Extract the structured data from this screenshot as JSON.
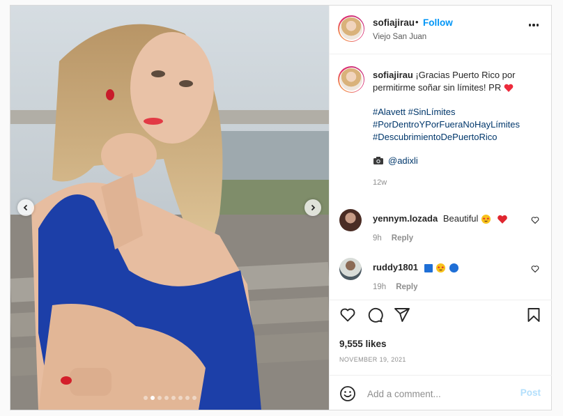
{
  "post": {
    "username": "sofiajirau",
    "separator": "•",
    "follow_label": "Follow",
    "location": "Viejo San Juan",
    "caption_text": "¡Gracias Puerto Rico por permitirme soñar sin límites! PR",
    "hashtags": [
      "#Alavett #SinLímites",
      "#PorDentroYPorFueraNoHayLímites",
      "#DescubrimientoDePuertoRico"
    ],
    "photo_credit": "@adixli",
    "caption_time": "12w",
    "likes": "9,555 likes",
    "date": "November 19, 2021"
  },
  "comments": [
    {
      "username": "yennym.lozada",
      "text": "Beautiful",
      "time": "9h",
      "reply_label": "Reply"
    },
    {
      "username": "ruddy1801",
      "text": "",
      "time": "19h",
      "reply_label": "Reply"
    }
  ],
  "add_comment": {
    "placeholder": "Add a comment...",
    "post_label": "Post"
  },
  "media": {
    "slide_count": 8,
    "active_slide": 2
  },
  "icons": {
    "more": "more-horizontal-icon",
    "like": "heart-icon",
    "comment": "comment-icon",
    "share": "paper-plane-icon",
    "save": "bookmark-icon",
    "emoji": "smiley-icon",
    "prev": "chevron-left-icon",
    "next": "chevron-right-icon",
    "camera": "camera-icon"
  },
  "colors": {
    "accent": "#0095f6",
    "heart": "#ed4956",
    "link": "#00376b",
    "muted": "#8e8e8e",
    "dress": "#1c3fa8"
  }
}
